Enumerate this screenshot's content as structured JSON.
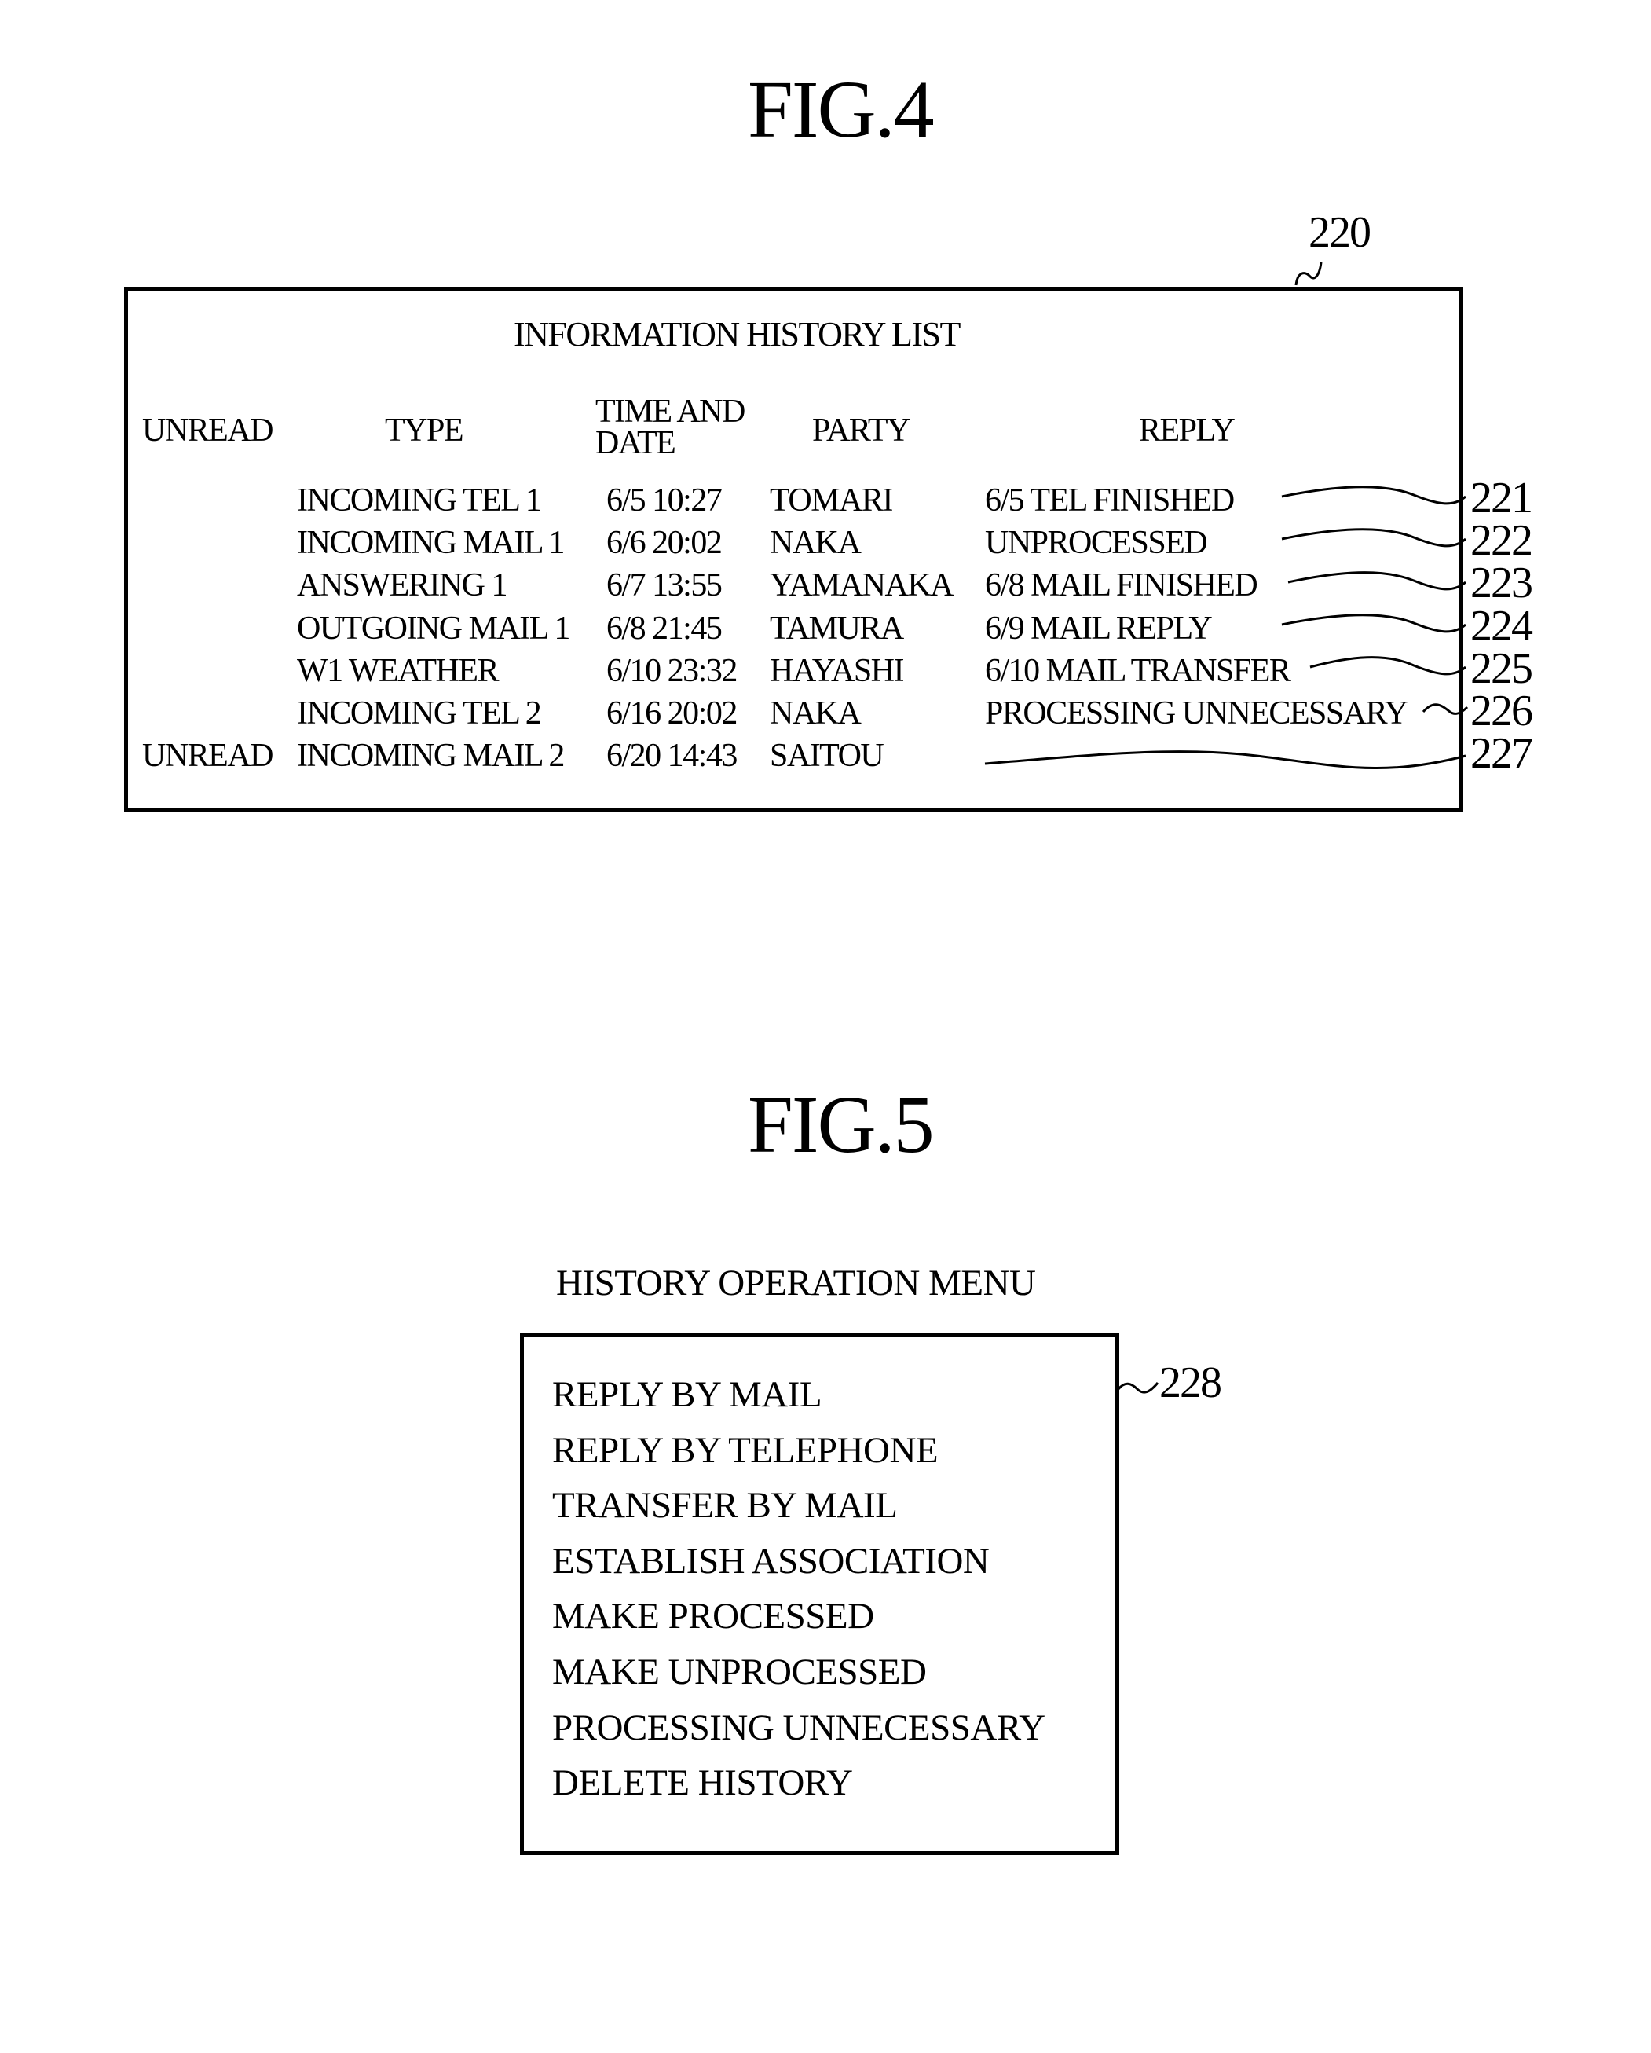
{
  "fig4": {
    "title": "FIG.4",
    "ref_number": "220",
    "panel_title": "INFORMATION HISTORY LIST",
    "headers": {
      "unread": "UNREAD",
      "type": "TYPE",
      "time_line1": "TIME AND",
      "time_line2": "DATE",
      "party": "PARTY",
      "reply": "REPLY"
    },
    "rows": [
      {
        "unread": "",
        "type": "INCOMING TEL 1",
        "time": "6/5 10:27",
        "party": "TOMARI",
        "reply": "6/5 TEL FINISHED",
        "ref": "221"
      },
      {
        "unread": "",
        "type": "INCOMING MAIL 1",
        "time": "6/6 20:02",
        "party": "NAKA",
        "reply": "UNPROCESSED",
        "ref": "222"
      },
      {
        "unread": "",
        "type": "ANSWERING 1",
        "time": "6/7 13:55",
        "party": "YAMANAKA",
        "reply": "6/8 MAIL FINISHED",
        "ref": "223"
      },
      {
        "unread": "",
        "type": "OUTGOING MAIL 1",
        "time": "6/8 21:45",
        "party": "TAMURA",
        "reply": "6/9 MAIL REPLY",
        "ref": "224"
      },
      {
        "unread": "",
        "type": "W1 WEATHER",
        "time": "6/10 23:32",
        "party": "HAYASHI",
        "reply": "6/10 MAIL TRANSFER",
        "ref": "225"
      },
      {
        "unread": "",
        "type": "INCOMING TEL 2",
        "time": "6/16 20:02",
        "party": "NAKA",
        "reply": "PROCESSING UNNECESSARY",
        "ref": "226"
      },
      {
        "unread": "UNREAD",
        "type": "INCOMING MAIL 2",
        "time": "6/20 14:43",
        "party": "SAITOU",
        "reply": "",
        "ref": "227"
      }
    ]
  },
  "fig5": {
    "title": "FIG.5",
    "menu_title": "HISTORY OPERATION MENU",
    "ref_number": "228",
    "items": [
      "REPLY BY MAIL",
      "REPLY BY TELEPHONE",
      "TRANSFER BY MAIL",
      "ESTABLISH ASSOCIATION",
      "MAKE PROCESSED",
      "MAKE UNPROCESSED",
      "PROCESSING UNNECESSARY",
      "DELETE HISTORY"
    ]
  }
}
